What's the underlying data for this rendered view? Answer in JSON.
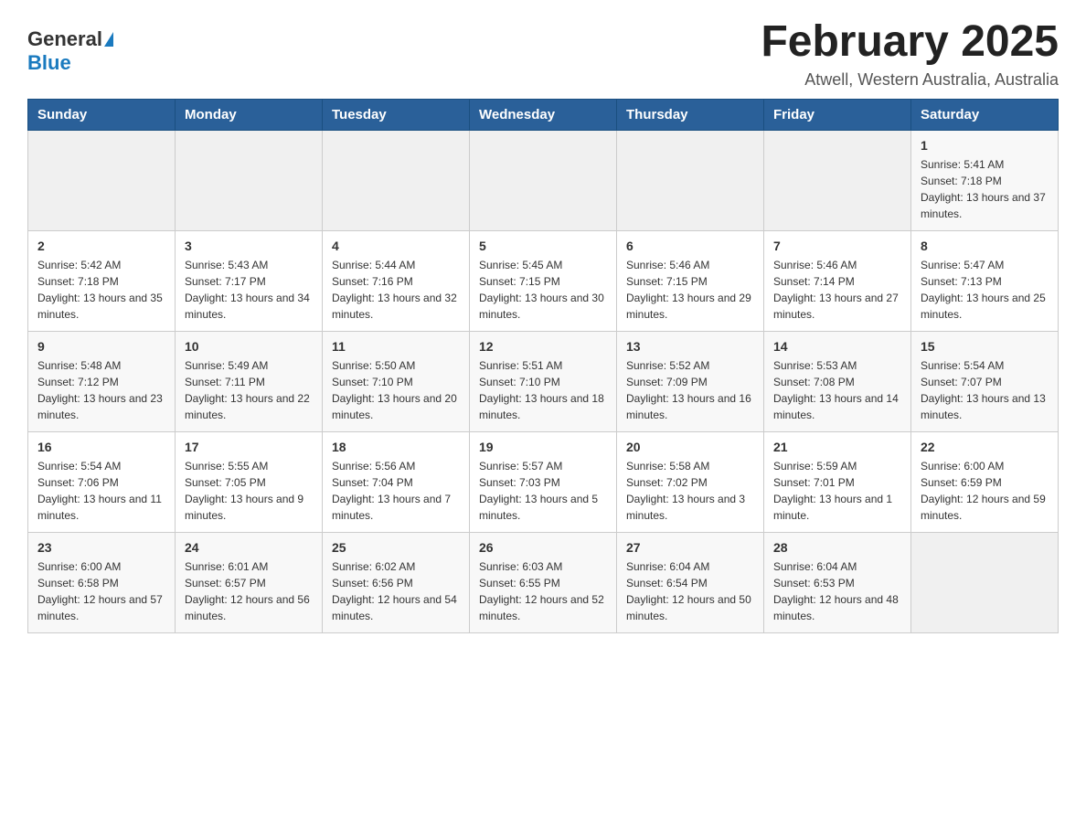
{
  "header": {
    "logo_general": "General",
    "logo_blue": "Blue",
    "month_title": "February 2025",
    "location": "Atwell, Western Australia, Australia"
  },
  "weekdays": [
    "Sunday",
    "Monday",
    "Tuesday",
    "Wednesday",
    "Thursday",
    "Friday",
    "Saturday"
  ],
  "weeks": [
    {
      "days": [
        {
          "num": "",
          "info": ""
        },
        {
          "num": "",
          "info": ""
        },
        {
          "num": "",
          "info": ""
        },
        {
          "num": "",
          "info": ""
        },
        {
          "num": "",
          "info": ""
        },
        {
          "num": "",
          "info": ""
        },
        {
          "num": "1",
          "info": "Sunrise: 5:41 AM\nSunset: 7:18 PM\nDaylight: 13 hours and 37 minutes."
        }
      ]
    },
    {
      "days": [
        {
          "num": "2",
          "info": "Sunrise: 5:42 AM\nSunset: 7:18 PM\nDaylight: 13 hours and 35 minutes."
        },
        {
          "num": "3",
          "info": "Sunrise: 5:43 AM\nSunset: 7:17 PM\nDaylight: 13 hours and 34 minutes."
        },
        {
          "num": "4",
          "info": "Sunrise: 5:44 AM\nSunset: 7:16 PM\nDaylight: 13 hours and 32 minutes."
        },
        {
          "num": "5",
          "info": "Sunrise: 5:45 AM\nSunset: 7:15 PM\nDaylight: 13 hours and 30 minutes."
        },
        {
          "num": "6",
          "info": "Sunrise: 5:46 AM\nSunset: 7:15 PM\nDaylight: 13 hours and 29 minutes."
        },
        {
          "num": "7",
          "info": "Sunrise: 5:46 AM\nSunset: 7:14 PM\nDaylight: 13 hours and 27 minutes."
        },
        {
          "num": "8",
          "info": "Sunrise: 5:47 AM\nSunset: 7:13 PM\nDaylight: 13 hours and 25 minutes."
        }
      ]
    },
    {
      "days": [
        {
          "num": "9",
          "info": "Sunrise: 5:48 AM\nSunset: 7:12 PM\nDaylight: 13 hours and 23 minutes."
        },
        {
          "num": "10",
          "info": "Sunrise: 5:49 AM\nSunset: 7:11 PM\nDaylight: 13 hours and 22 minutes."
        },
        {
          "num": "11",
          "info": "Sunrise: 5:50 AM\nSunset: 7:10 PM\nDaylight: 13 hours and 20 minutes."
        },
        {
          "num": "12",
          "info": "Sunrise: 5:51 AM\nSunset: 7:10 PM\nDaylight: 13 hours and 18 minutes."
        },
        {
          "num": "13",
          "info": "Sunrise: 5:52 AM\nSunset: 7:09 PM\nDaylight: 13 hours and 16 minutes."
        },
        {
          "num": "14",
          "info": "Sunrise: 5:53 AM\nSunset: 7:08 PM\nDaylight: 13 hours and 14 minutes."
        },
        {
          "num": "15",
          "info": "Sunrise: 5:54 AM\nSunset: 7:07 PM\nDaylight: 13 hours and 13 minutes."
        }
      ]
    },
    {
      "days": [
        {
          "num": "16",
          "info": "Sunrise: 5:54 AM\nSunset: 7:06 PM\nDaylight: 13 hours and 11 minutes."
        },
        {
          "num": "17",
          "info": "Sunrise: 5:55 AM\nSunset: 7:05 PM\nDaylight: 13 hours and 9 minutes."
        },
        {
          "num": "18",
          "info": "Sunrise: 5:56 AM\nSunset: 7:04 PM\nDaylight: 13 hours and 7 minutes."
        },
        {
          "num": "19",
          "info": "Sunrise: 5:57 AM\nSunset: 7:03 PM\nDaylight: 13 hours and 5 minutes."
        },
        {
          "num": "20",
          "info": "Sunrise: 5:58 AM\nSunset: 7:02 PM\nDaylight: 13 hours and 3 minutes."
        },
        {
          "num": "21",
          "info": "Sunrise: 5:59 AM\nSunset: 7:01 PM\nDaylight: 13 hours and 1 minute."
        },
        {
          "num": "22",
          "info": "Sunrise: 6:00 AM\nSunset: 6:59 PM\nDaylight: 12 hours and 59 minutes."
        }
      ]
    },
    {
      "days": [
        {
          "num": "23",
          "info": "Sunrise: 6:00 AM\nSunset: 6:58 PM\nDaylight: 12 hours and 57 minutes."
        },
        {
          "num": "24",
          "info": "Sunrise: 6:01 AM\nSunset: 6:57 PM\nDaylight: 12 hours and 56 minutes."
        },
        {
          "num": "25",
          "info": "Sunrise: 6:02 AM\nSunset: 6:56 PM\nDaylight: 12 hours and 54 minutes."
        },
        {
          "num": "26",
          "info": "Sunrise: 6:03 AM\nSunset: 6:55 PM\nDaylight: 12 hours and 52 minutes."
        },
        {
          "num": "27",
          "info": "Sunrise: 6:04 AM\nSunset: 6:54 PM\nDaylight: 12 hours and 50 minutes."
        },
        {
          "num": "28",
          "info": "Sunrise: 6:04 AM\nSunset: 6:53 PM\nDaylight: 12 hours and 48 minutes."
        },
        {
          "num": "",
          "info": ""
        }
      ]
    }
  ]
}
